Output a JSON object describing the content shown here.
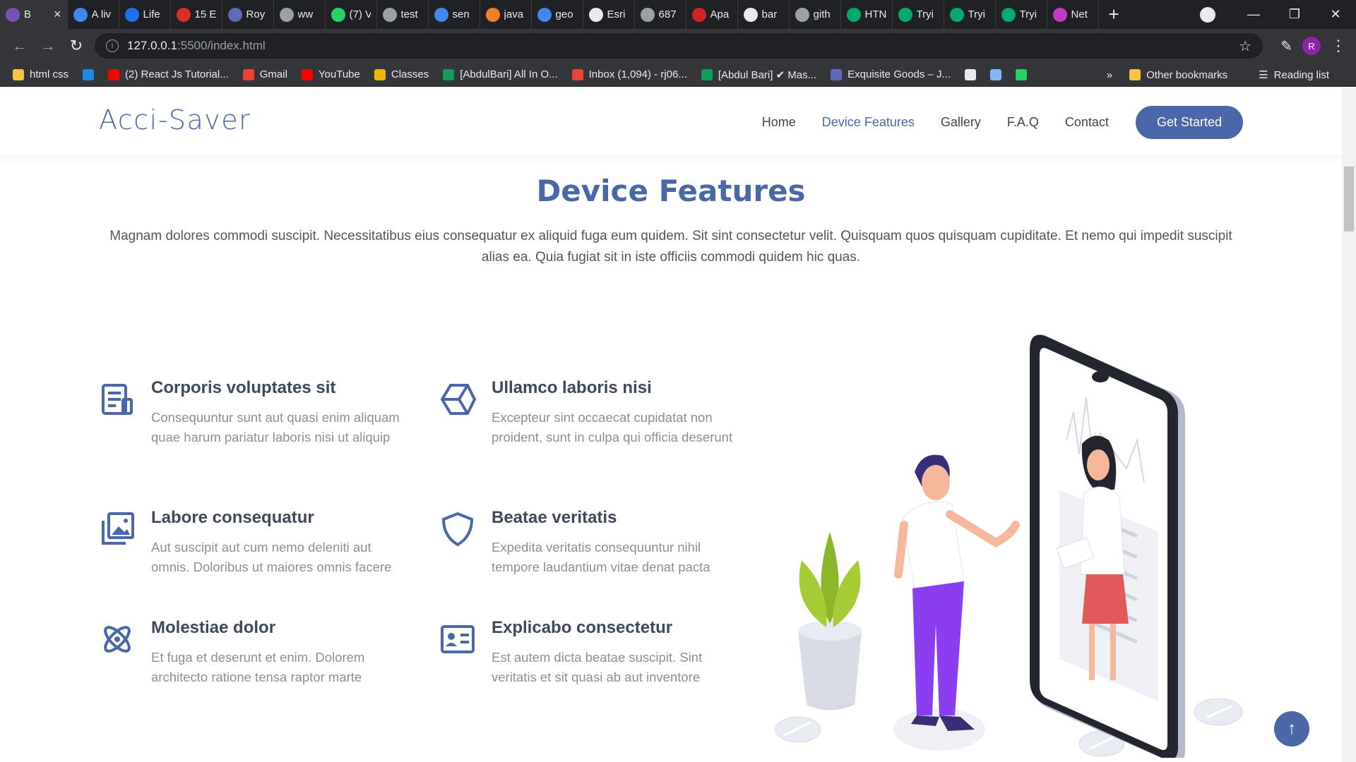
{
  "browser": {
    "tabs": [
      {
        "label": "B",
        "icon": "bootstrap-icon",
        "color": "#7952b3",
        "active": true
      },
      {
        "label": "A liv",
        "icon": "google-icon",
        "color": "#4285f4"
      },
      {
        "label": "Life",
        "icon": "play-icon",
        "color": "#1a73e8"
      },
      {
        "label": "15 E",
        "icon": "car-icon",
        "color": "#d93025"
      },
      {
        "label": "Roy",
        "icon": "app-icon",
        "color": "#5f6ab5"
      },
      {
        "label": "ww",
        "icon": "globe-icon",
        "color": "#9aa0a6"
      },
      {
        "label": "(7) V",
        "icon": "whatsapp-icon",
        "color": "#25d366"
      },
      {
        "label": "test",
        "icon": "globe-icon",
        "color": "#9aa0a6"
      },
      {
        "label": "sen",
        "icon": "google-icon",
        "color": "#4285f4"
      },
      {
        "label": "java",
        "icon": "stackoverflow-icon",
        "color": "#f48024"
      },
      {
        "label": "geo",
        "icon": "google-icon",
        "color": "#4285f4"
      },
      {
        "label": "Esri",
        "icon": "github-icon",
        "color": "#e8eaed"
      },
      {
        "label": "687",
        "icon": "globe-icon",
        "color": "#9aa0a6"
      },
      {
        "label": "Apa",
        "icon": "feather-icon",
        "color": "#d22128"
      },
      {
        "label": "bar",
        "icon": "github-icon",
        "color": "#e8eaed"
      },
      {
        "label": "gith",
        "icon": "globe-icon",
        "color": "#9aa0a6"
      },
      {
        "label": "HTN",
        "icon": "w3-icon",
        "color": "#04aa6d"
      },
      {
        "label": "Tryi",
        "icon": "w3-icon",
        "color": "#04aa6d"
      },
      {
        "label": "Tryi",
        "icon": "w3-icon",
        "color": "#04aa6d"
      },
      {
        "label": "Tryi",
        "icon": "w3-icon",
        "color": "#04aa6d"
      },
      {
        "label": "Net",
        "icon": "umbrella-icon",
        "color": "#c43bc2"
      }
    ],
    "url_host": "127.0.0.1",
    "url_path": ":5500/index.html",
    "profile_initial": "R",
    "bookmarks": [
      {
        "label": "html css",
        "color": "#f6c343"
      },
      {
        "label": "",
        "color": "#1e88e5"
      },
      {
        "label": "(2) React Js Tutorial...",
        "color": "#ff0000"
      },
      {
        "label": "Gmail",
        "color": "#ea4335"
      },
      {
        "label": "YouTube",
        "color": "#ff0000"
      },
      {
        "label": "Classes",
        "color": "#f4b400"
      },
      {
        "label": "[AbdulBari] All In O...",
        "color": "#0f9d58"
      },
      {
        "label": "Inbox (1,094) - rj06...",
        "color": "#ea4335"
      },
      {
        "label": "[Abdul Bari] ✔ Mas...",
        "color": "#0f9d58"
      },
      {
        "label": "Exquisite Goods – J...",
        "color": "#5c6bc0"
      },
      {
        "label": "",
        "color": "#e8eaed"
      },
      {
        "label": "",
        "color": "#8ab4f8"
      },
      {
        "label": "",
        "color": "#25d366"
      }
    ],
    "more_bookmarks": "»",
    "other_bookmarks": "Other bookmarks",
    "reading_list": "Reading list"
  },
  "site": {
    "logo": "Acci-Saver",
    "nav": [
      {
        "label": "Home",
        "active": false
      },
      {
        "label": "Device Features",
        "active": true
      },
      {
        "label": "Gallery",
        "active": false
      },
      {
        "label": "F.A.Q",
        "active": false
      },
      {
        "label": "Contact",
        "active": false
      }
    ],
    "cta": "Get Started",
    "section_title": "Device Features",
    "intro": "Magnam dolores commodi suscipit. Necessitatibus eius consequatur ex aliquid fuga eum quidem. Sit sint consectetur velit. Quisquam quos quisquam cupiditate. Et nemo qui impedit suscipit alias ea. Quia fugiat sit in iste officiis commodi quidem hic quas.",
    "features": [
      {
        "title": "Corporis voluptates sit",
        "text": "Consequuntur sunt aut quasi enim aliquam quae harum pariatur laboris nisi ut aliquip",
        "icon": "document-list-icon"
      },
      {
        "title": "Ullamco laboris nisi",
        "text": "Excepteur sint occaecat cupidatat non proident, sunt in culpa qui officia deserunt",
        "icon": "hexagon-cube-icon"
      },
      {
        "title": "Labore consequatur",
        "text": "Aut suscipit aut cum nemo deleniti aut omnis. Doloribus ut maiores omnis facere",
        "icon": "images-icon"
      },
      {
        "title": "Beatae veritatis",
        "text": "Expedita veritatis consequuntur nihil tempore laudantium vitae denat pacta",
        "icon": "shield-icon"
      },
      {
        "title": "Molestiae dolor",
        "text": "Et fuga et deserunt et enim. Dolorem architecto ratione tensa raptor marte",
        "icon": "atom-icon"
      },
      {
        "title": "Explicabo consectetur",
        "text": "Est autem dicta beatae suscipit. Sint veritatis et sit quasi ab aut inventore",
        "icon": "id-card-icon"
      }
    ],
    "back_to_top_icon": "arrow-up-icon",
    "accent_color": "#4a68a8"
  }
}
